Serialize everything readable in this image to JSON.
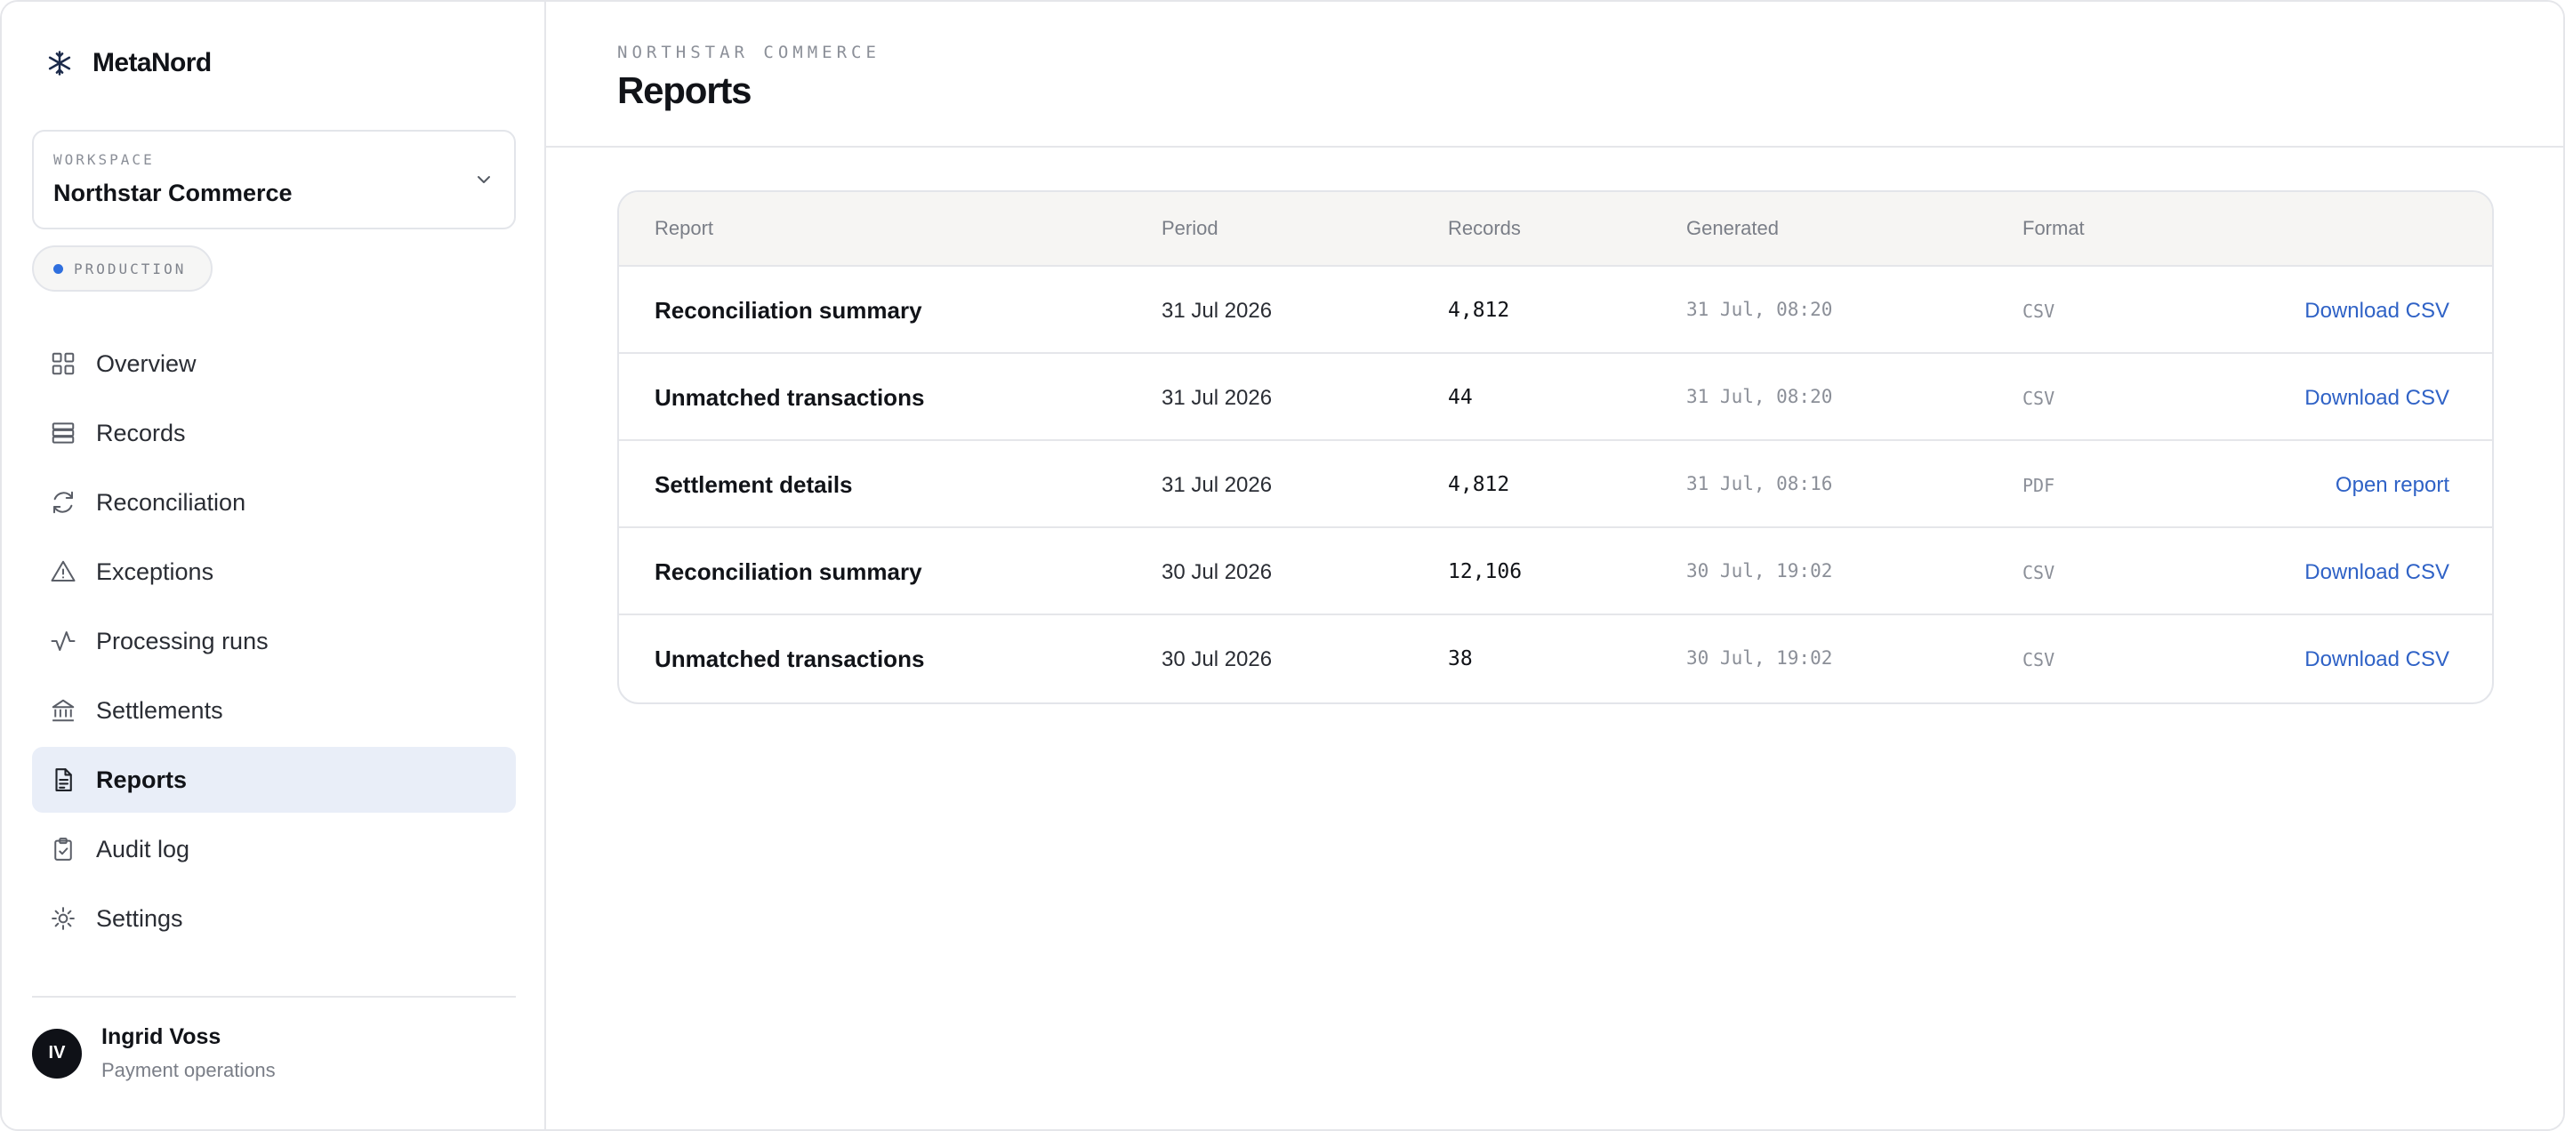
{
  "brand": {
    "name": "MetaNord",
    "icon": "snowflake-icon"
  },
  "workspace": {
    "label": "WORKSPACE",
    "name": "Northstar Commerce",
    "icon": "chevron-down-icon"
  },
  "environment": {
    "label": "PRODUCTION",
    "dot_color": "#2f6fde"
  },
  "nav": {
    "items": [
      {
        "label": "Overview",
        "icon": "grid-icon"
      },
      {
        "label": "Records",
        "icon": "database-icon"
      },
      {
        "label": "Reconciliation",
        "icon": "refresh-icon"
      },
      {
        "label": "Exceptions",
        "icon": "warning-triangle-icon"
      },
      {
        "label": "Processing runs",
        "icon": "activity-icon"
      },
      {
        "label": "Settlements",
        "icon": "bank-icon"
      },
      {
        "label": "Reports",
        "icon": "document-icon",
        "active": true
      },
      {
        "label": "Audit log",
        "icon": "clipboard-check-icon"
      },
      {
        "label": "Settings",
        "icon": "gear-icon"
      }
    ]
  },
  "user": {
    "initials": "IV",
    "name": "Ingrid Voss",
    "role": "Payment operations"
  },
  "header": {
    "eyebrow": "NORTHSTAR COMMERCE",
    "title": "Reports"
  },
  "table": {
    "columns": {
      "report": "Report",
      "period": "Period",
      "records": "Records",
      "generated": "Generated",
      "format": "Format"
    },
    "rows": [
      {
        "report": "Reconciliation summary",
        "period": "31 Jul 2026",
        "records": "4,812",
        "generated": "31 Jul, 08:20",
        "format": "CSV",
        "action": "Download CSV"
      },
      {
        "report": "Unmatched transactions",
        "period": "31 Jul 2026",
        "records": "44",
        "generated": "31 Jul, 08:20",
        "format": "CSV",
        "action": "Download CSV"
      },
      {
        "report": "Settlement details",
        "period": "31 Jul 2026",
        "records": "4,812",
        "generated": "31 Jul, 08:16",
        "format": "PDF",
        "action": "Open report"
      },
      {
        "report": "Reconciliation summary",
        "period": "30 Jul 2026",
        "records": "12,106",
        "generated": "30 Jul, 19:02",
        "format": "CSV",
        "action": "Download CSV"
      },
      {
        "report": "Unmatched transactions",
        "period": "30 Jul 2026",
        "records": "38",
        "generated": "30 Jul, 19:02",
        "format": "CSV",
        "action": "Download CSV"
      }
    ]
  },
  "colors": {
    "accent": "#2f62c6",
    "active_nav_bg": "#e9eef8",
    "header_bg": "#f6f5f3",
    "text": "#111318"
  }
}
